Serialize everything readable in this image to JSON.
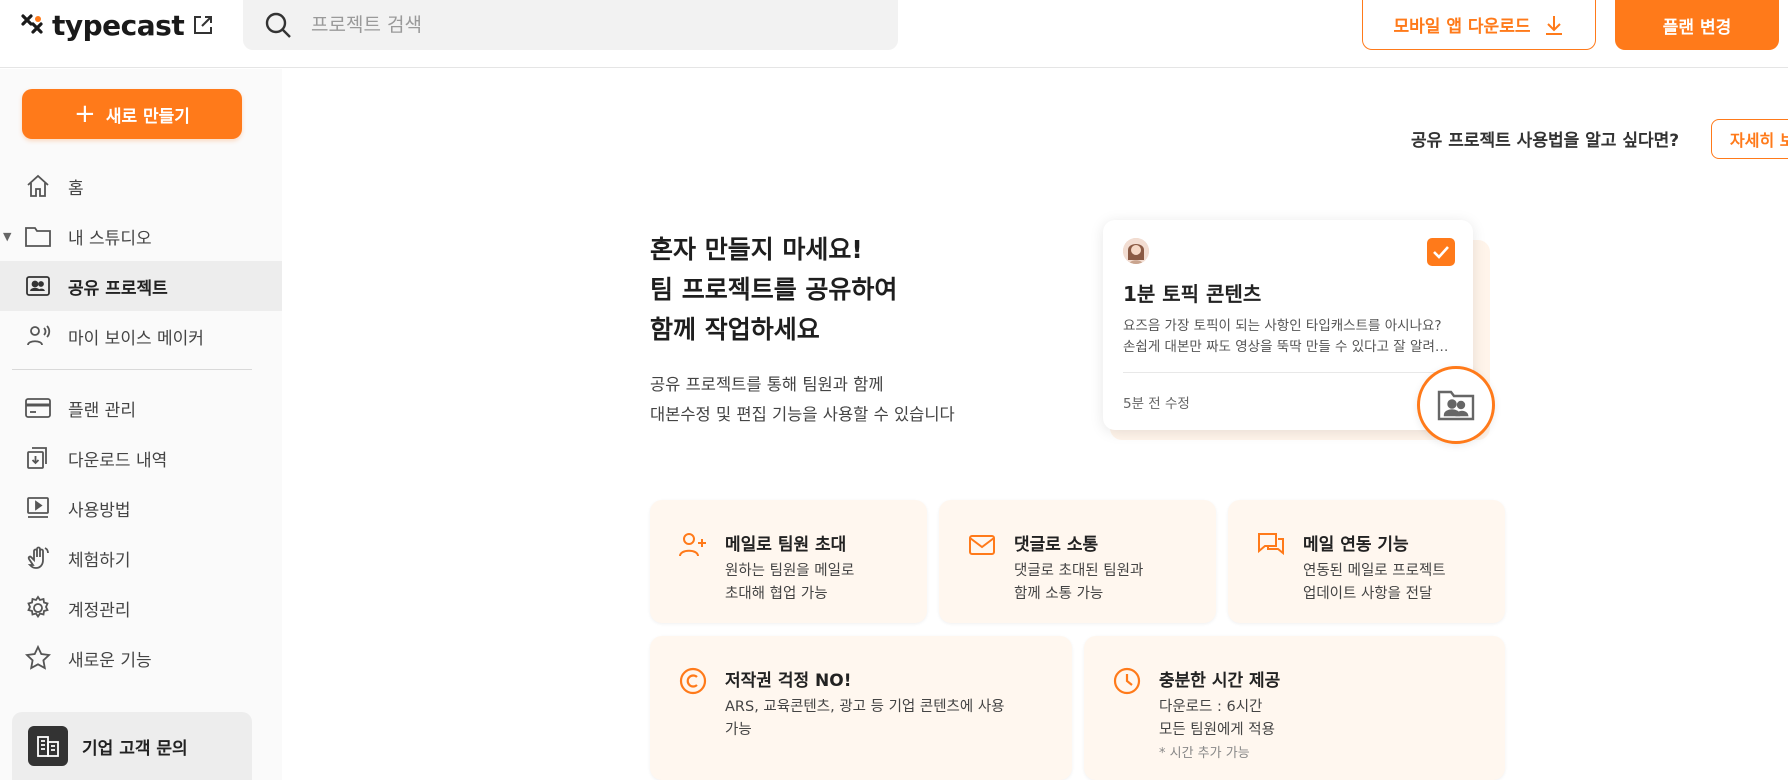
{
  "header": {
    "logo_text": "typecast",
    "search_placeholder": "프로젝트 검색",
    "mobile_download_label": "모바일 앱 다운로드",
    "plan_change_label": "플랜 변경"
  },
  "sidebar": {
    "new_button_label": "새로 만들기",
    "items": [
      {
        "label": "홈"
      },
      {
        "label": "내 스튜디오"
      },
      {
        "label": "공유 프로젝트"
      },
      {
        "label": "마이 보이스 메이커"
      },
      {
        "label": "플랜 관리"
      },
      {
        "label": "다운로드 내역"
      },
      {
        "label": "사용방법"
      },
      {
        "label": "체험하기"
      },
      {
        "label": "계정관리"
      },
      {
        "label": "새로운 기능"
      }
    ],
    "enterprise_label": "기업 고객 문의"
  },
  "main": {
    "help_note": "공유 프로젝트 사용법을 알고 싶다면?",
    "detail_button_label": "자세히 보기",
    "hero_title_lines": [
      "혼자 만들지 마세요!",
      "팀 프로젝트를 공유하여",
      "함께 작업하세요"
    ],
    "hero_sub_lines": [
      "공유 프로젝트를 통해 팀원과 함께",
      "대본수정 및 편집 기능을 사용할 수 있습니다"
    ],
    "preview_card": {
      "title": "1분 토픽 콘텐츠",
      "desc_lines": [
        "요즈음 가장 토픽이 되는 사항인 타입캐스트를 아시나요?",
        "손쉽게 대본만 짜도 영상을 뚝딱 만들 수 있다고 잘 알려진 서비스입니다"
      ],
      "time": "5분 전 수정"
    },
    "features": [
      {
        "title": "메일로 팀원 초대",
        "lines": [
          "원하는 팀원을 메일로",
          "초대해 협업 가능"
        ]
      },
      {
        "title": "댓글로 소통",
        "lines": [
          "댓글로 초대된 팀원과",
          "함께 소통 가능"
        ]
      },
      {
        "title": "메일 연동 기능",
        "lines": [
          "연동된 메일로 프로젝트",
          "업데이트 사항을 전달"
        ]
      },
      {
        "title": "저작권 걱정 NO!",
        "lines": [
          "ARS, 교육콘텐츠, 광고 등 기업 콘텐츠에 사용",
          "가능"
        ]
      },
      {
        "title": "충분한 시간 제공",
        "lines": [
          "다운로드 : 6시간",
          "모든 팀원에게 적용"
        ],
        "note": "* 시간 추가 가능"
      }
    ]
  },
  "colors": {
    "accent": "#ff7a1a",
    "text": "#222222"
  }
}
